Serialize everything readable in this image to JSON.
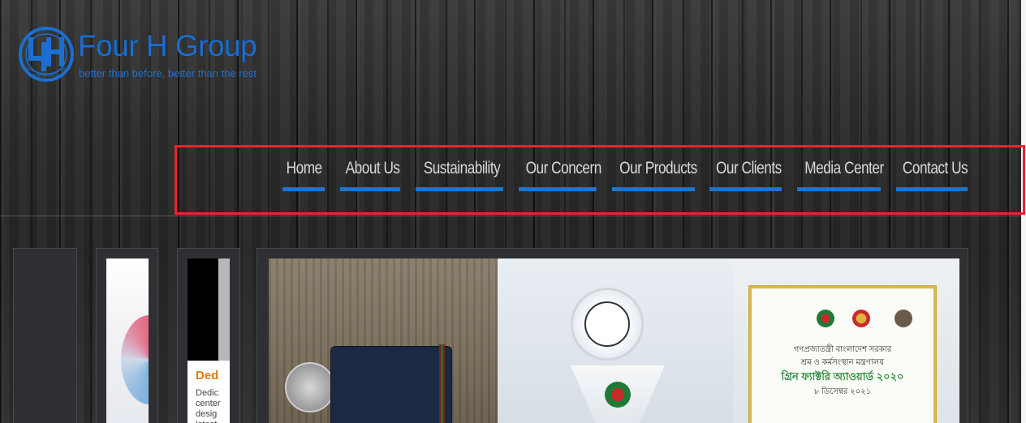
{
  "brand": {
    "title": "Four H Group",
    "tagline": "better than before, better than the rest",
    "mark_text": "FOUR H GROUP",
    "color": "#1a6fd0"
  },
  "nav": {
    "items": [
      {
        "label": "Home"
      },
      {
        "label": "About Us"
      },
      {
        "label": "Sustainability"
      },
      {
        "label": "Our Concern"
      },
      {
        "label": "Our Products"
      },
      {
        "label": "Our Clients"
      },
      {
        "label": "Media Center"
      },
      {
        "label": "Contact Us"
      }
    ],
    "underline_color": "#1f74c7",
    "highlight_color": "#e8262c"
  },
  "panels": {
    "thumb3_heading": "Ded",
    "thumb3_text": [
      "Dedic",
      "center",
      "desig",
      "latest"
    ]
  },
  "slide": {
    "certificate": {
      "line1": "গণপ্রজাতন্ত্রী বাংলাদেশ সরকার",
      "line2": "শ্রম ও কর্মসংস্থান মন্ত্রণালয়",
      "line3": "গ্রিন ফ্যাক্টরি অ্যাওয়ার্ড ২০২০",
      "line4": "৮ ডিসেম্বর ২০২১"
    }
  }
}
